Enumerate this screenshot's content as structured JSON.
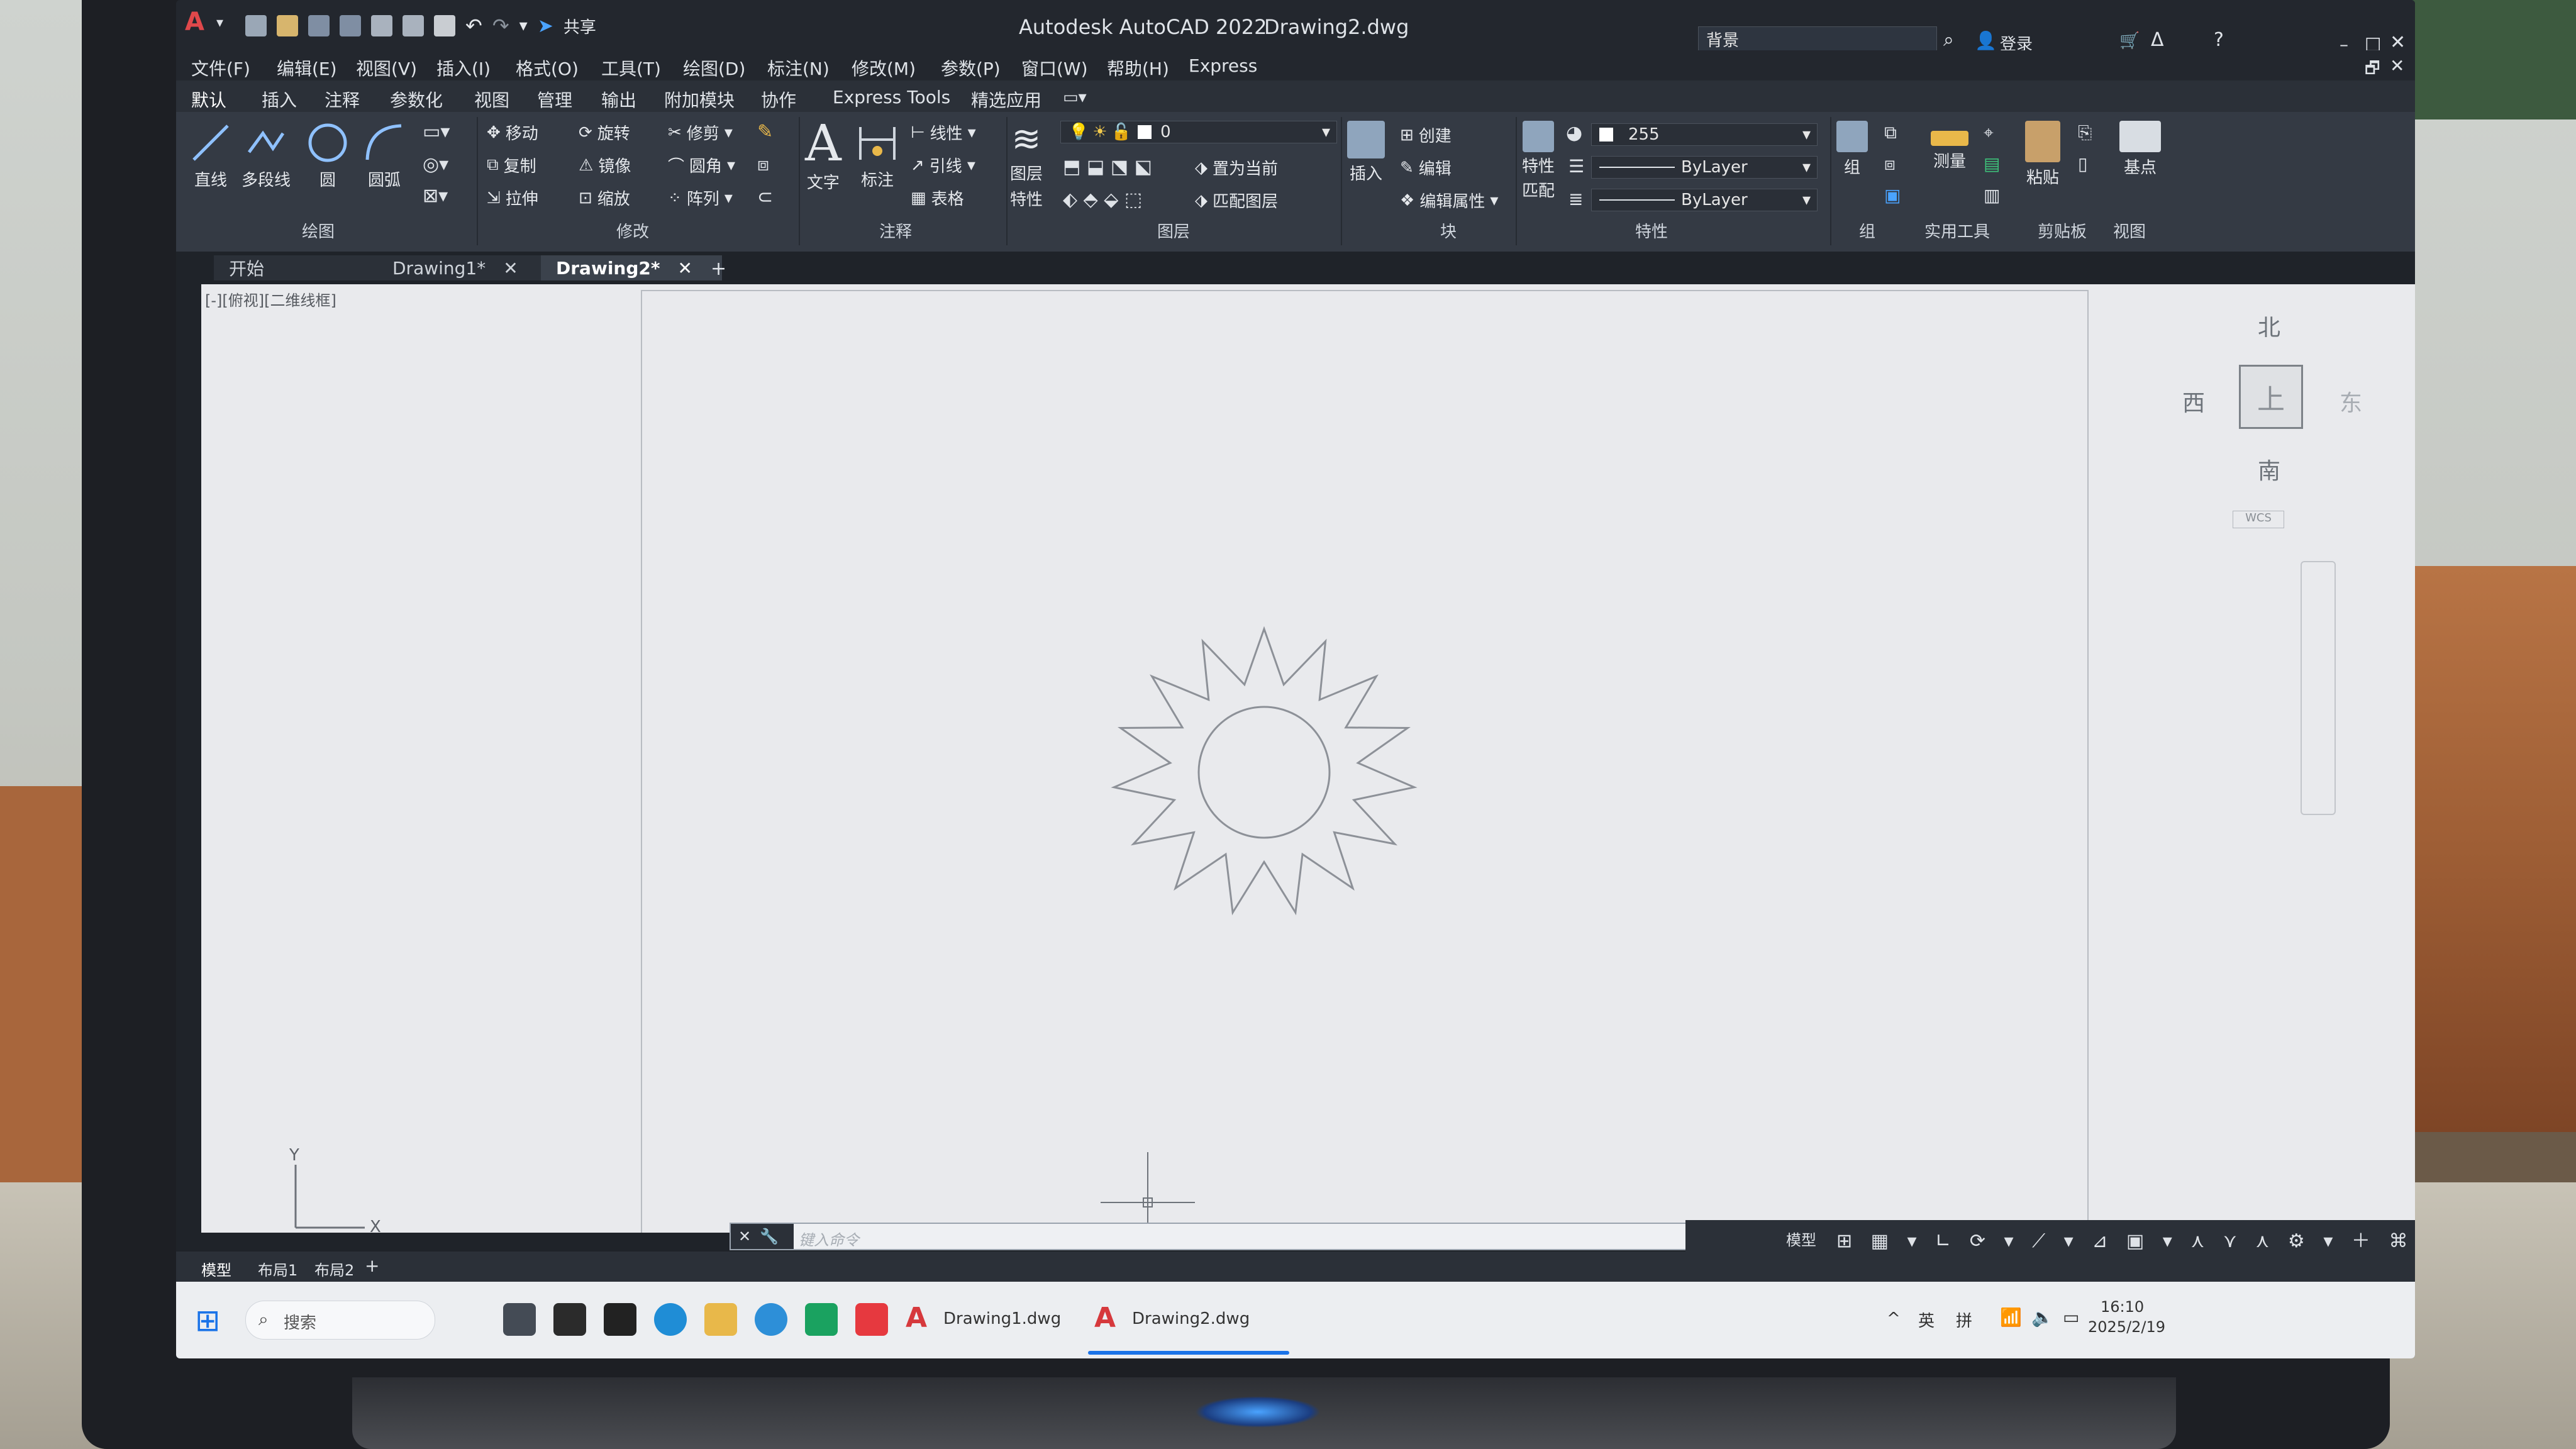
{
  "window": {
    "app_title": "Autodesk AutoCAD 2022",
    "file_title": "Drawing2.dwg",
    "search_placeholder": "背景",
    "login_label": "登录",
    "share_label": "共享"
  },
  "menu": [
    "文件(F)",
    "编辑(E)",
    "视图(V)",
    "插入(I)",
    "格式(O)",
    "工具(T)",
    "绘图(D)",
    "标注(N)",
    "修改(M)",
    "参数(P)",
    "窗口(W)",
    "帮助(H)",
    "Express"
  ],
  "ribbon_tabs": [
    "默认",
    "插入",
    "注释",
    "参数化",
    "视图",
    "管理",
    "输出",
    "附加模块",
    "协作",
    "Express Tools",
    "精选应用"
  ],
  "ribbon": {
    "draw": {
      "line": "直线",
      "polyline": "多段线",
      "circle": "圆",
      "arc": "圆弧",
      "panel": "绘图"
    },
    "modify": {
      "move": "移动",
      "rotate": "旋转",
      "trim": "修剪",
      "copy": "复制",
      "mirror": "镜像",
      "fillet": "圆角",
      "stretch": "拉伸",
      "scale": "缩放",
      "array": "阵列",
      "panel": "修改"
    },
    "annotation": {
      "text": "文字",
      "dimension": "标注",
      "linear": "线性",
      "leader": "引线",
      "table": "表格",
      "panel": "注释"
    },
    "layers": {
      "layer_props_line1": "图层",
      "layer_props_line2": "特性",
      "current_layer": "0",
      "set_current": "置为当前",
      "match_layer": "匹配图层",
      "panel": "图层"
    },
    "block": {
      "insert": "插入",
      "create": "创建",
      "edit": "编辑",
      "edit_attr": "编辑属性",
      "panel": "块"
    },
    "properties": {
      "match_line1": "特性",
      "match_line2": "匹配",
      "color": "255",
      "linetype": "ByLayer",
      "lineweight": "ByLayer",
      "panel": "特性"
    },
    "groups": {
      "group": "组",
      "panel": "组"
    },
    "utilities": {
      "measure": "测量",
      "panel": "实用工具"
    },
    "clipboard": {
      "paste": "粘贴",
      "panel": "剪贴板"
    },
    "view": {
      "base": "基点",
      "panel": "视图"
    }
  },
  "doc_tabs": [
    "开始",
    "Drawing1*",
    "Drawing2*"
  ],
  "viewport_label": "[-][俯视][二维线框]",
  "viewcube": {
    "north": "北",
    "south": "南",
    "east": "东",
    "west": "西",
    "top": "上",
    "wcs": "WCS"
  },
  "ucs": {
    "x": "X",
    "y": "Y"
  },
  "command_placeholder": "键入命令",
  "layout_tabs": [
    "模型",
    "布局1",
    "布局2"
  ],
  "status_model": "模型",
  "taskbar": {
    "search": "搜索",
    "apps": [
      "Drawing1.dwg",
      "Drawing2.dwg"
    ],
    "lang1": "英",
    "lang2": "拼",
    "time": "16:10",
    "date": "2025/2/19"
  }
}
